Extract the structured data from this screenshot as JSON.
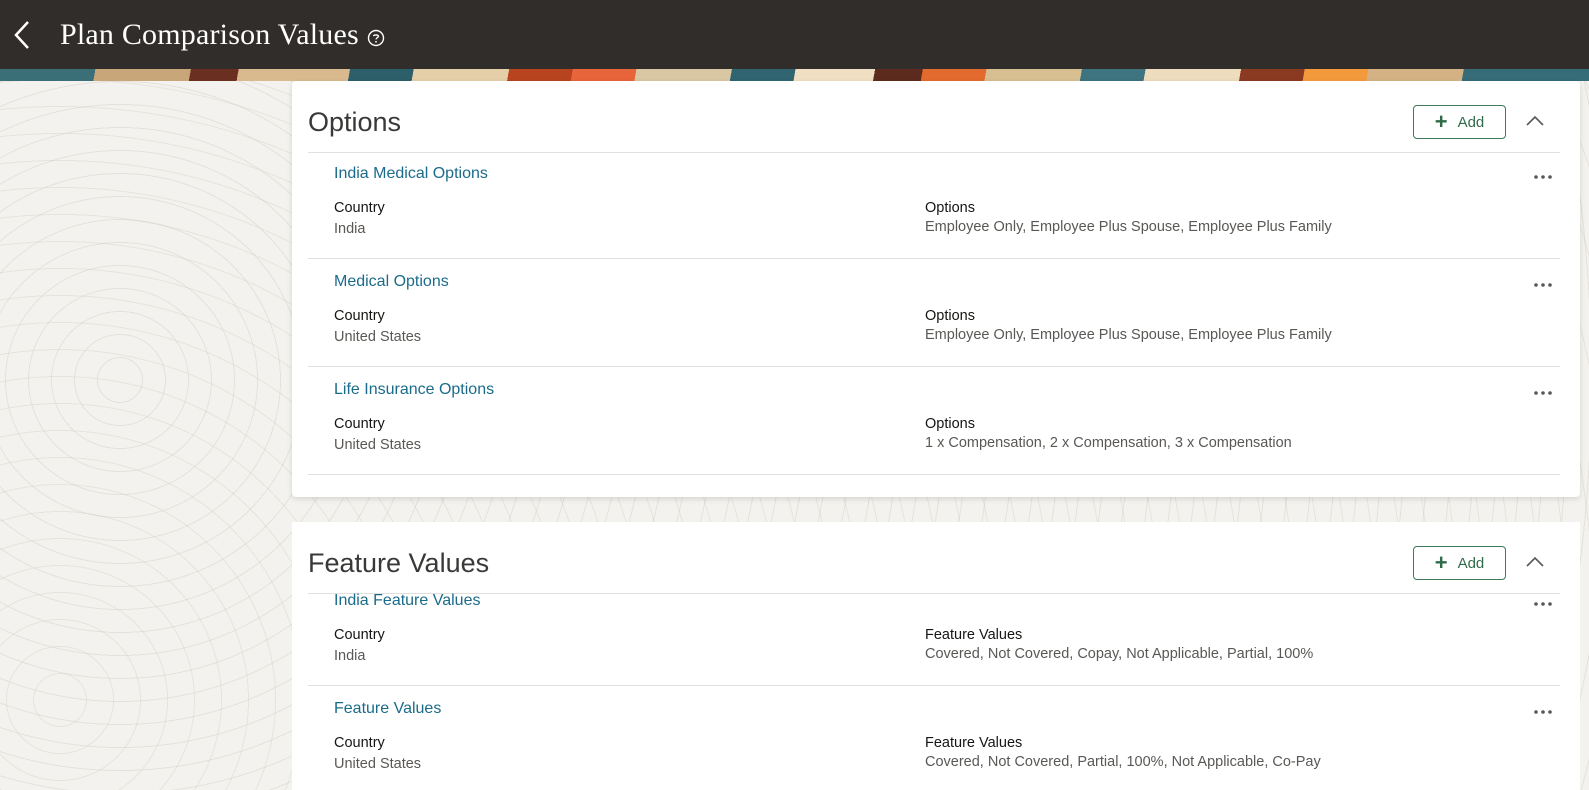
{
  "header": {
    "title": "Plan Comparison Values",
    "back_icon": "chevron-left-icon",
    "help_icon": "question-circle-icon"
  },
  "sections": [
    {
      "title": "Options",
      "add_label": "Add",
      "rows": [
        {
          "title": "India Medical Options",
          "col1_label": "Country",
          "col1_value": "India",
          "col2_label": "Options",
          "col2_value": "Employee Only, Employee Plus Spouse, Employee Plus Family"
        },
        {
          "title": "Medical Options",
          "col1_label": "Country",
          "col1_value": "United States",
          "col2_label": "Options",
          "col2_value": "Employee Only, Employee Plus Spouse, Employee Plus Family"
        },
        {
          "title": "Life Insurance Options",
          "col1_label": "Country",
          "col1_value": "United States",
          "col2_label": "Options",
          "col2_value": "1 x Compensation, 2 x Compensation, 3 x Compensation"
        }
      ]
    },
    {
      "title": "Feature Values",
      "add_label": "Add",
      "rows": [
        {
          "title": "India Feature Values",
          "col1_label": "Country",
          "col1_value": "India",
          "col2_label": "Feature Values",
          "col2_value": "Covered, Not Covered, Copay, Not Applicable, Partial, 100%"
        },
        {
          "title": "Feature Values",
          "col1_label": "Country",
          "col1_value": "United States",
          "col2_label": "Feature Values",
          "col2_value": "Covered, Not Covered, Partial, 100%, Not Applicable, Co-Pay"
        }
      ]
    }
  ],
  "colors": {
    "header_bg": "#312d2a",
    "link": "#1b6b8a",
    "add_button": "#2f6b4a"
  }
}
